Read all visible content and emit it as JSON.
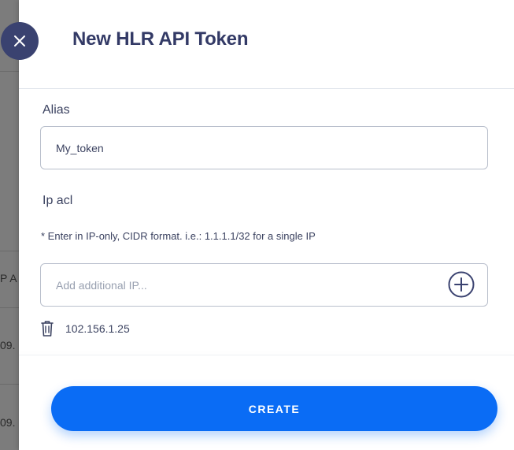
{
  "backdrop": {
    "fragments": [
      "P A",
      "09.",
      "09."
    ]
  },
  "drawer": {
    "title": "New HLR API Token"
  },
  "form": {
    "alias_label": "Alias",
    "alias_value": "My_token",
    "ip_acl_label": "Ip acl",
    "ip_hint": "* Enter in IP-only, CIDR format. i.e.: 1.1.1.1/32 for a single IP",
    "ip_placeholder": "Add additional IP...",
    "ip_list": [
      "102.156.1.25"
    ]
  },
  "actions": {
    "create_label": "CREATE"
  },
  "icons": {
    "close": "close-icon",
    "add": "plus-circle-icon",
    "delete": "trash-icon"
  },
  "colors": {
    "accent": "#0a6cf5",
    "close_bg": "#3a4270",
    "title": "#333a66"
  }
}
